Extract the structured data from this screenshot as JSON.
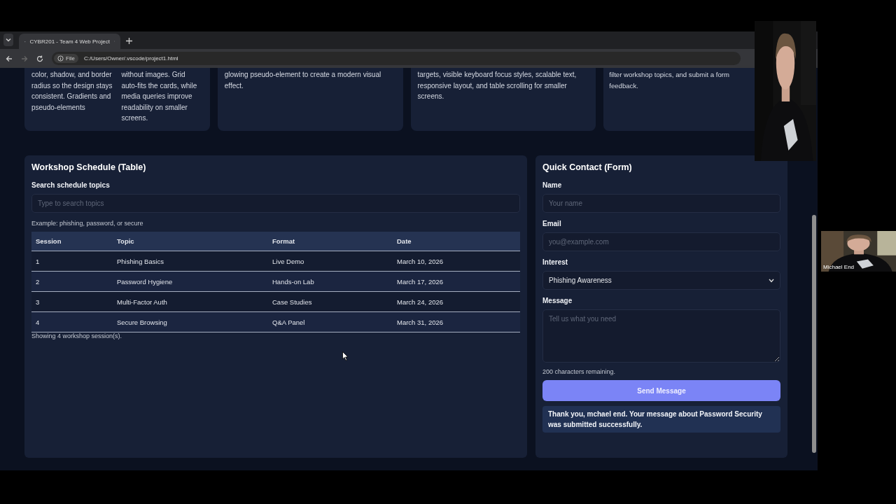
{
  "browser": {
    "tab_title": "CYBR201 - Team 4 Web Project",
    "url_chip": "File",
    "url": "C:/Users/Owner/.vscode/project1.html"
  },
  "cards": [
    {
      "paragraphs": [
        "color, shadow, and border radius so the design stays consistent. Gradients and pseudo-elements",
        "without images. Grid auto-fits the cards, while media queries improve readability on smaller screens."
      ]
    },
    {
      "paragraphs": [
        "glowing pseudo-element to create a modern visual effect."
      ]
    },
    {
      "paragraphs": [
        "targets, visible keyboard focus styles, scalable text, responsive layout, and table scrolling for smaller screens."
      ]
    },
    {
      "paragraphs": [
        "filter workshop topics, and submit a form",
        "feedback."
      ]
    }
  ],
  "schedule": {
    "title": "Workshop Schedule (Table)",
    "search_label": "Search schedule topics",
    "search_placeholder": "Type to search topics",
    "hint": "Example: phishing, password, or secure",
    "columns": [
      "Session",
      "Topic",
      "Format",
      "Date"
    ],
    "rows": [
      [
        "1",
        "Phishing Basics",
        "Live Demo",
        "March 10, 2026"
      ],
      [
        "2",
        "Password Hygiene",
        "Hands-on Lab",
        "March 17, 2026"
      ],
      [
        "3",
        "Multi-Factor Auth",
        "Case Studies",
        "March 24, 2026"
      ],
      [
        "4",
        "Secure Browsing",
        "Q&A Panel",
        "March 31, 2026"
      ]
    ],
    "footer": "Showing 4 workshop session(s)."
  },
  "contact": {
    "title": "Quick Contact (Form)",
    "fields": [
      {
        "kind": "input",
        "label": "Name",
        "placeholder": "Your name"
      },
      {
        "kind": "input",
        "label": "Email",
        "placeholder": "you@example.com"
      },
      {
        "kind": "select",
        "label": "Interest",
        "value": "Phishing Awareness"
      },
      {
        "kind": "textarea",
        "label": "Message",
        "placeholder": "Tell us what you need"
      }
    ],
    "counter": "200 characters remaining.",
    "button": "Send Message",
    "confirmation": "Thank you, mchael end. Your message about Password Security was submitted successfully."
  },
  "webcams": [
    {
      "kind": "picture"
    },
    {
      "kind": "picture",
      "name": "Michael End"
    }
  ]
}
